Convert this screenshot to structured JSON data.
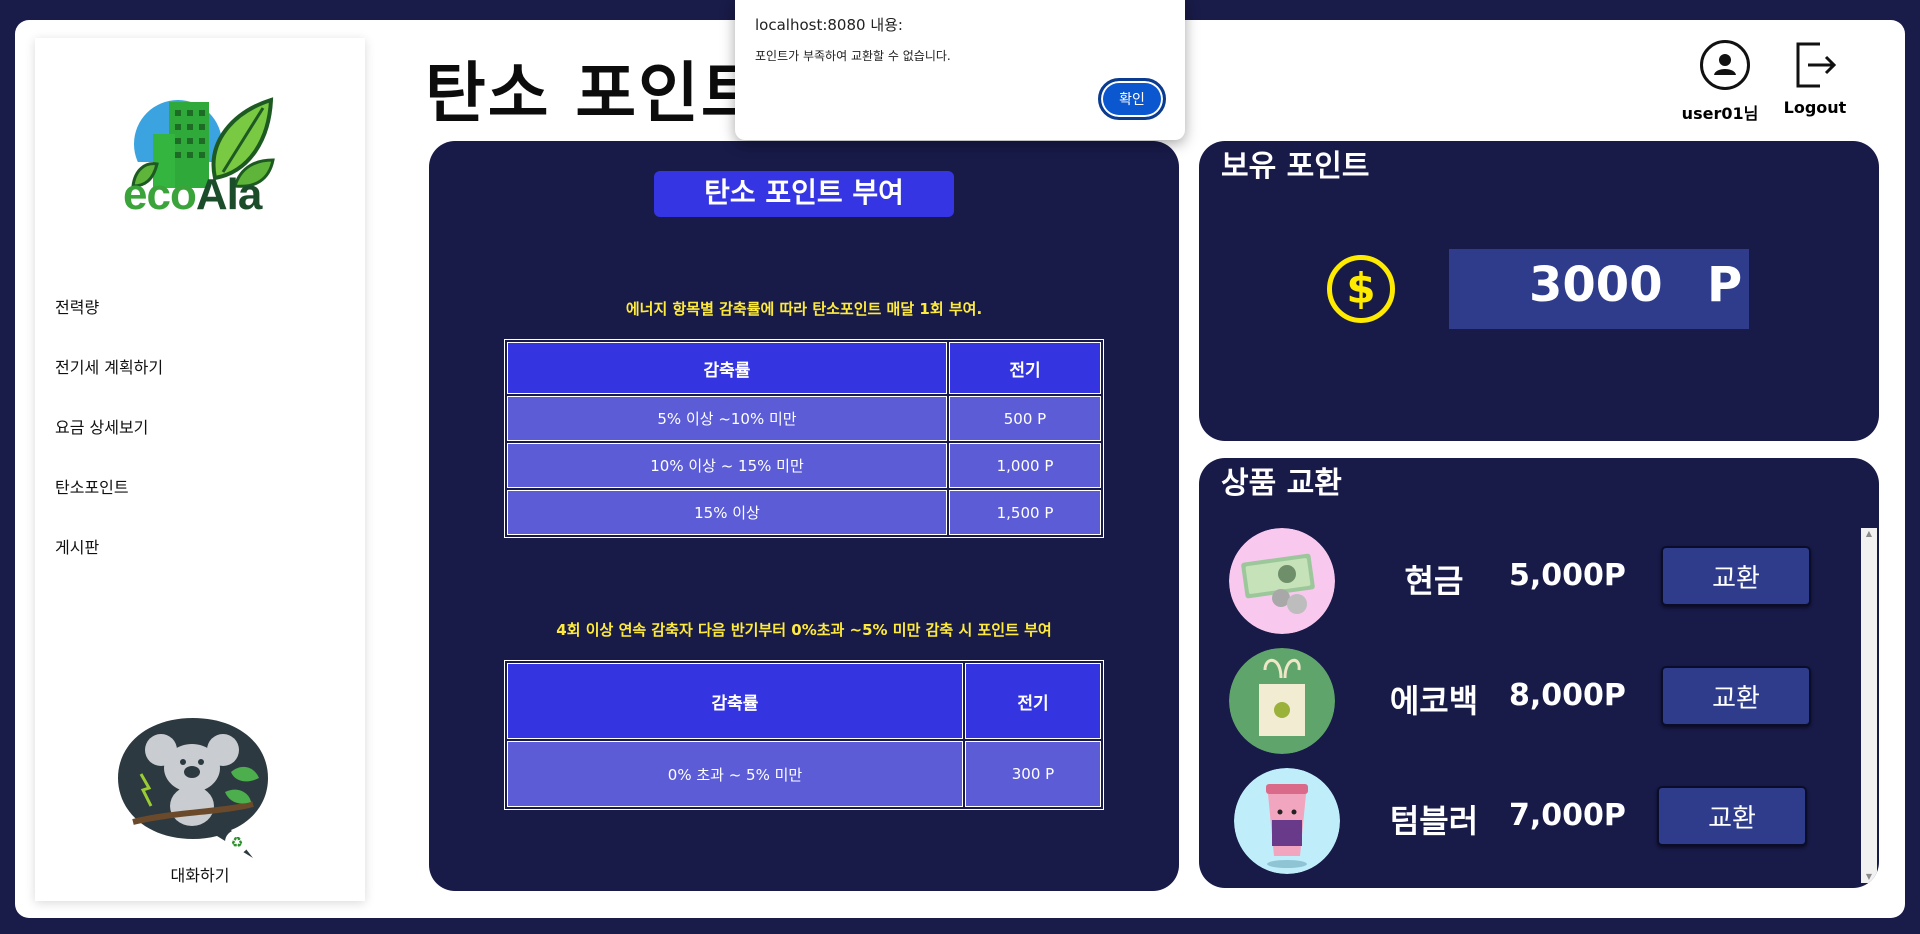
{
  "logo": {
    "eco": "eco",
    "ala": "Ala"
  },
  "sidebar": {
    "items": [
      {
        "label": "전력량"
      },
      {
        "label": "전기세 계획하기"
      },
      {
        "label": "요금 상세보기"
      },
      {
        "label": "탄소포인트"
      },
      {
        "label": "게시판"
      }
    ],
    "chat_label": "대화하기"
  },
  "header": {
    "title": "탄소 포인트",
    "user_label": "user01님",
    "logout_label": "Logout"
  },
  "award": {
    "title": "탄소 포인트 부여",
    "note1": "에너지 항목별 감축률에 따라 탄소포인트 매달 1회 부여.",
    "table1": {
      "headers": [
        "감축률",
        "전기"
      ],
      "rows": [
        [
          "5% 이상 ~10% 미만",
          "500 P"
        ],
        [
          "10% 이상 ~ 15% 미만",
          "1,000 P"
        ],
        [
          "15% 이상",
          "1,500 P"
        ]
      ]
    },
    "note2": "4회 이상 연속 감축자 다음 반기부터 0%초과 ~5% 미만 감축 시 포인트 부여",
    "table2": {
      "headers": [
        "감축률",
        "전기"
      ],
      "rows": [
        [
          "0% 초과 ~ 5% 미만",
          "300 P"
        ]
      ]
    }
  },
  "points": {
    "title": "보유 포인트",
    "coin_symbol": "$",
    "value": "3000",
    "unit": "P"
  },
  "exchange": {
    "title": "상품 교환",
    "items": [
      {
        "name": "현금",
        "price": "5,000P",
        "button": "교환",
        "icon": "cash-icon"
      },
      {
        "name": "에코백",
        "price": "8,000P",
        "button": "교환",
        "icon": "ecobag-icon"
      },
      {
        "name": "텀블러",
        "price": "7,000P",
        "button": "교환",
        "icon": "tumbler-icon"
      }
    ]
  },
  "alert": {
    "origin": "localhost:8080 내용:",
    "message": "포인트가 부족하여 교환할 수 없습니다.",
    "ok": "확인"
  },
  "colors": {
    "navy": "#181a48",
    "accent_blue": "#3535e3",
    "row_blue": "#5b5cd6",
    "note_yellow": "#ffeb3b",
    "coin_yellow": "#ffeb00"
  }
}
